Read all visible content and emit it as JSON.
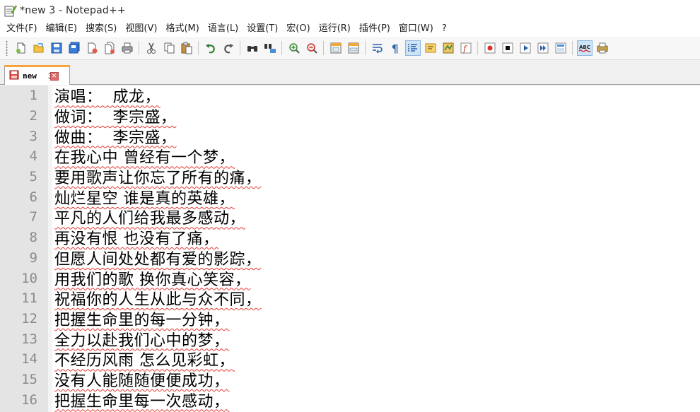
{
  "window": {
    "title": "*new 3 - Notepad++"
  },
  "menu": [
    "文件(F)",
    "编辑(E)",
    "搜索(S)",
    "视图(V)",
    "格式(M)",
    "语言(L)",
    "设置(T)",
    "宏(O)",
    "运行(R)",
    "插件(P)",
    "窗口(W)",
    "?"
  ],
  "toolbar": {
    "icons": [
      "new-file-icon",
      "open-file-icon",
      "save-icon",
      "save-all-icon",
      "close-icon",
      "close-all-icon",
      "print-icon",
      "cut-icon",
      "copy-icon",
      "paste-icon",
      "undo-icon",
      "redo-icon",
      "find-icon",
      "replace-icon",
      "zoom-in-icon",
      "zoom-out-icon",
      "sync-vertical-icon",
      "sync-horizontal-icon",
      "word-wrap-icon",
      "show-all-chars-icon",
      "indent-guide-icon",
      "udl-icon",
      "doc-map-icon",
      "function-list-icon",
      "record-macro-icon",
      "stop-record-icon",
      "play-macro-icon",
      "run-macro-multiple-icon",
      "save-macro-icon",
      "spell-check-icon",
      "print-preview-icon"
    ]
  },
  "tab": {
    "label": "new",
    "number": "3"
  },
  "editor": {
    "lines": [
      "演唱：  成龙，",
      "做词：  李宗盛，",
      "做曲：  李宗盛，",
      "在我心中 曾经有一个梦，",
      "要用歌声让你忘了所有的痛，",
      "灿烂星空 谁是真的英雄，",
      "平凡的人们给我最多感动，",
      "再没有恨 也没有了痛，",
      "但愿人间处处都有爱的影踪，",
      "用我们的歌 换你真心笑容，",
      "祝福你的人生从此与众不同，",
      "把握生命里的每一分钟，",
      "全力以赴我们心中的梦，",
      "不经历风雨 怎么见彩虹，",
      "没有人能随随便便成功，",
      "把握生命里每一次感动，"
    ],
    "line_numbers": [
      "1",
      "2",
      "3",
      "4",
      "5",
      "6",
      "7",
      "8",
      "9",
      "10",
      "11",
      "12",
      "13",
      "14",
      "15",
      "16"
    ]
  }
}
